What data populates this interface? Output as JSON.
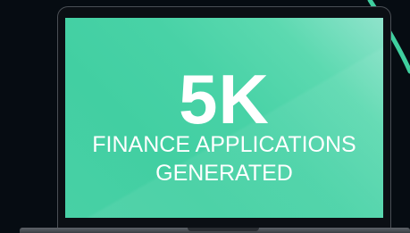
{
  "colors": {
    "background": "#060c12",
    "screen_primary": "#48d2a6",
    "screen_highlight": "#8fe3cb",
    "accent_arc": "#3fcf9f",
    "text": "#ffffff"
  },
  "stat": {
    "value": "5K",
    "caption_line_1": "FINANCE APPLICATIONS",
    "caption_line_2": "GENERATED"
  }
}
